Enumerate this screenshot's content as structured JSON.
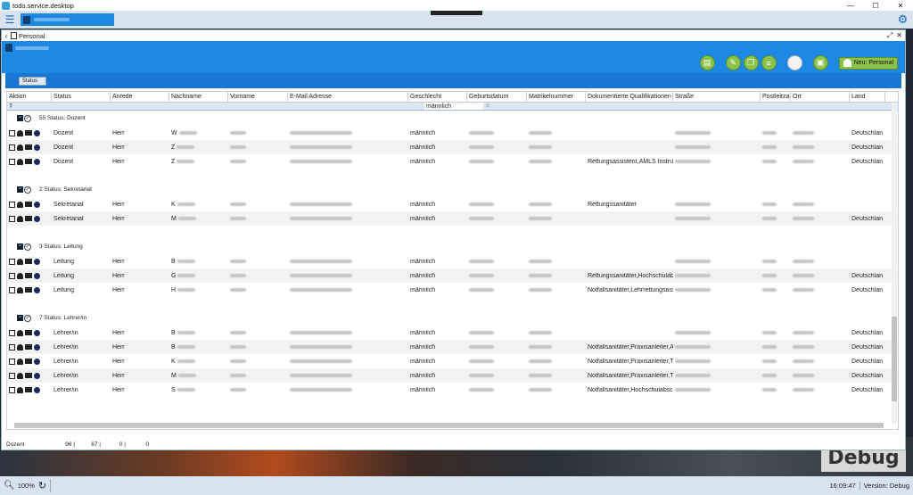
{
  "window": {
    "title": "todo.service.desktop"
  },
  "page": {
    "title": "Personal"
  },
  "toolbar": {
    "new_label": "Neu: Personal"
  },
  "groupbar": {
    "chip_label": "Status"
  },
  "columns": [
    "Aktion",
    "Status",
    "Anrede",
    "Nachname",
    "Vorname",
    "E-Mail Adresse",
    "Geschlecht",
    "Geburtsdatum",
    "Matrikelnummer",
    "Dokumentierte Qualifikationen",
    "Straße",
    "Postleitzahl",
    "Ort",
    "Land"
  ],
  "filter": {
    "geschlecht": "männlich",
    "clear": "✕"
  },
  "groups": [
    {
      "header": "55 Status: Dozent",
      "rows": [
        {
          "status": "Dozent",
          "anrede": "Herr",
          "nachname": "W",
          "geschlecht": "männlich",
          "quali": "",
          "land": "Deutschlan"
        },
        {
          "status": "Dozent",
          "anrede": "Herr",
          "nachname": "Z",
          "geschlecht": "männlich",
          "quali": "",
          "land": "Deutschlan"
        },
        {
          "status": "Dozent",
          "anrede": "Herr",
          "nachname": "Z",
          "geschlecht": "männlich",
          "quali": "Rettungsassistent,AMLS Instruktor",
          "land": "Deutschlan"
        }
      ]
    },
    {
      "header": "2 Status: Sekretariat",
      "rows": [
        {
          "status": "Sekretariat",
          "anrede": "Herr",
          "nachname": "K",
          "geschlecht": "männlich",
          "quali": "Rettungssanitäter",
          "land": ""
        },
        {
          "status": "Sekretariat",
          "anrede": "Herr",
          "nachname": "M",
          "geschlecht": "männlich",
          "quali": "",
          "land": "Deutschlan"
        }
      ]
    },
    {
      "header": "3 Status: Leitung",
      "rows": [
        {
          "status": "Leitung",
          "anrede": "Herr",
          "nachname": "B",
          "geschlecht": "männlich",
          "quali": "",
          "land": ""
        },
        {
          "status": "Leitung",
          "anrede": "Herr",
          "nachname": "G",
          "geschlecht": "männlich",
          "quali": "Rettungssanitäter,Hochschulabsch",
          "land": "Deutschlan"
        },
        {
          "status": "Leitung",
          "anrede": "Herr",
          "nachname": "H",
          "geschlecht": "männlich",
          "quali": "Notfallsanitäter,Lehrrettungsassist",
          "land": "Deutschlan"
        }
      ]
    },
    {
      "header": "7 Status: Lehrer/in",
      "rows": [
        {
          "status": "Lehrer/in",
          "anrede": "Herr",
          "nachname": "B",
          "geschlecht": "männlich",
          "quali": "",
          "land": "Deutschlan"
        },
        {
          "status": "Lehrer/in",
          "anrede": "Herr",
          "nachname": "B",
          "geschlecht": "männlich",
          "quali": "Notfallsanitäter,Praxisanleiter,AML",
          "land": "Deutschlan"
        },
        {
          "status": "Lehrer/in",
          "anrede": "Herr",
          "nachname": "K",
          "geschlecht": "männlich",
          "quali": "Notfallsanitäter,Praxisanleiter,Trau",
          "land": "Deutschlan"
        },
        {
          "status": "Lehrer/in",
          "anrede": "Herr",
          "nachname": "M",
          "geschlecht": "männlich",
          "quali": "Notfallsanitäter,Praxisanleiter,Trau",
          "land": "Deutschlan"
        },
        {
          "status": "Lehrer/in",
          "anrede": "Herr",
          "nachname": "S",
          "geschlecht": "männlich",
          "quali": "Notfallsanitäter,Hochschulabschlu",
          "land": "Deutschlan"
        }
      ]
    }
  ],
  "footer": {
    "label": "Dozent",
    "c1": "96 |",
    "c2": "67 |",
    "c3": "0 |",
    "c4": "0"
  },
  "status": {
    "zoom": "100%",
    "time": "16:09:47",
    "version": "Version: Debug"
  },
  "badge": {
    "text": "Debug"
  }
}
